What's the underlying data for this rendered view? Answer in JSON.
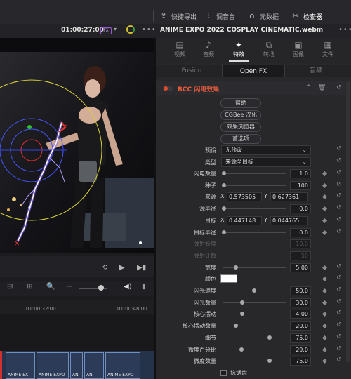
{
  "toolbar": {
    "items": [
      {
        "label": "快捷导出",
        "icon": "export-icon"
      },
      {
        "label": "调音台",
        "icon": "mixer-icon"
      },
      {
        "label": "元数据",
        "icon": "metadata-icon"
      },
      {
        "label": "检查器",
        "icon": "inspector-icon"
      }
    ]
  },
  "viewer": {
    "timecode": "01:00:27:00",
    "fx_badge": "FX"
  },
  "inspector": {
    "clip_title": "ANIME EXPO 2022 COSPLAY CINEMATIC.webm",
    "tabs": [
      "视频",
      "音频",
      "特效",
      "转场",
      "图像",
      "文件"
    ],
    "active_tab": "特效",
    "subtabs": [
      "Fusion",
      "Open FX",
      "音频"
    ],
    "active_subtab": "Open FX",
    "effect_name": "BCC 闪电效果",
    "effect_enabled": true,
    "buttons": [
      "帮助",
      "CGBee 汉化",
      "效果浏览器",
      "首选项"
    ],
    "preset_label": "预设",
    "preset_value": "无预设",
    "type_label": "类型",
    "type_value": "来源至目标",
    "params": [
      {
        "label": "闪电数量",
        "value": "1.0",
        "pos": 0.0
      },
      {
        "label": "种子",
        "value": "100",
        "pos": 0.0
      },
      {
        "label": "来源",
        "x": "0.573505",
        "y": "0.627361"
      },
      {
        "label": "源半径",
        "value": "0.0",
        "pos": 0.0
      },
      {
        "label": "目标",
        "x": "0.447148",
        "y": "0.044765"
      },
      {
        "label": "目标半径",
        "value": "0.0",
        "pos": 0.0
      },
      {
        "label": "弹射长度",
        "value": "10.0",
        "disabled": true
      },
      {
        "label": "弹射计数",
        "value": "50",
        "disabled": true
      },
      {
        "label": "宽度",
        "value": "5.00",
        "pos": 0.2
      },
      {
        "label": "颜色",
        "color": "#ffffff"
      },
      {
        "label": "闪光速度",
        "value": "50.0",
        "pos": 0.5
      },
      {
        "label": "闪光数量",
        "value": "30.0",
        "pos": 0.3
      },
      {
        "label": "核心摆动",
        "value": "4.00",
        "pos": 0.3
      },
      {
        "label": "核心摆动数量",
        "value": "20.0",
        "pos": 0.2
      },
      {
        "label": "细节",
        "value": "75.0",
        "pos": 0.75
      },
      {
        "label": "微度百分比",
        "value": "29.0",
        "pos": 0.29
      },
      {
        "label": "微度数量",
        "value": "75.0",
        "pos": 0.75
      }
    ],
    "checkbox_label": "抗锯齿"
  },
  "timeline": {
    "times": [
      "01:00:32:00",
      "01:00:48:00"
    ],
    "clips": [
      "ANIME EX",
      "ANIME EXPO",
      "AN",
      "ANI",
      "ANIME EXPO"
    ]
  },
  "colors": {
    "accent_effect": "#e85a3a",
    "lightning": "#8e6bff",
    "clip": "#2b3b58"
  }
}
